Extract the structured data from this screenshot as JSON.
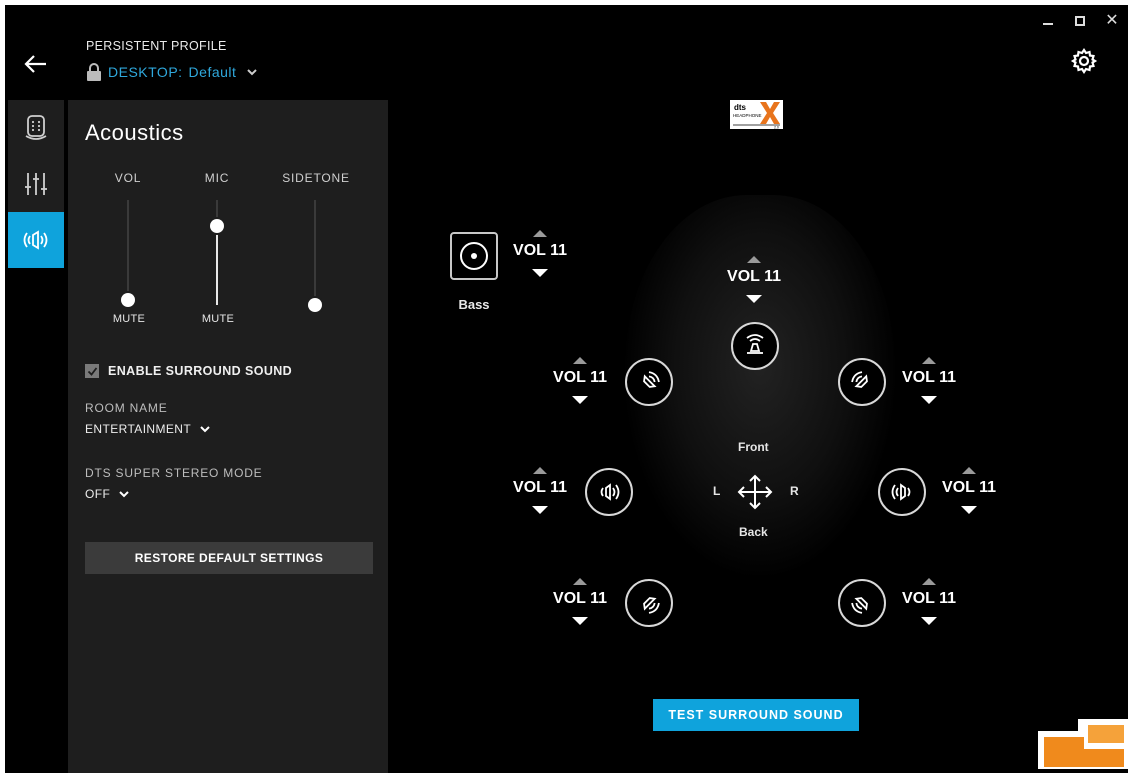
{
  "profile": {
    "label": "PERSISTENT PROFILE",
    "prefix": "DESKTOP:",
    "name": "Default"
  },
  "nav": {
    "items": [
      {
        "icon": "headset-mic-icon",
        "active": false
      },
      {
        "icon": "equalizer-icon",
        "active": false
      },
      {
        "icon": "surround-speaker-icon",
        "active": true
      }
    ]
  },
  "acoustics": {
    "title": "Acoustics",
    "sliders": [
      {
        "label": "VOL",
        "level": 0.05,
        "mute_label": "MUTE"
      },
      {
        "label": "MIC",
        "level": 0.75,
        "mute_label": "MUTE"
      },
      {
        "label": "SIDETONE",
        "level": 0.0,
        "mute_label": ""
      }
    ],
    "enable_surround": {
      "label": "ENABLE SURROUND SOUND",
      "checked": true
    },
    "room_name": {
      "label": "ROOM NAME",
      "value": "ENTERTAINMENT"
    },
    "dts_mode": {
      "label": "DTS SUPER STEREO MODE",
      "value": "OFF"
    },
    "restore_label": "RESTORE DEFAULT SETTINGS"
  },
  "surround": {
    "bass": {
      "label": "Bass",
      "volume": "VOL 11"
    },
    "center": {
      "volume": "VOL 11"
    },
    "front_left": {
      "volume": "VOL 11"
    },
    "front_right": {
      "volume": "VOL 11"
    },
    "side_left": {
      "volume": "VOL 11"
    },
    "side_right": {
      "volume": "VOL 11"
    },
    "rear_left": {
      "volume": "VOL 11"
    },
    "rear_right": {
      "volume": "VOL 11"
    },
    "directions": {
      "front": "Front",
      "back": "Back",
      "left": "L",
      "right": "R"
    },
    "test_label": "TEST SURROUND SOUND"
  },
  "colors": {
    "accent": "#0fa3dc",
    "panel": "#1e1e1e",
    "background": "#000000"
  }
}
